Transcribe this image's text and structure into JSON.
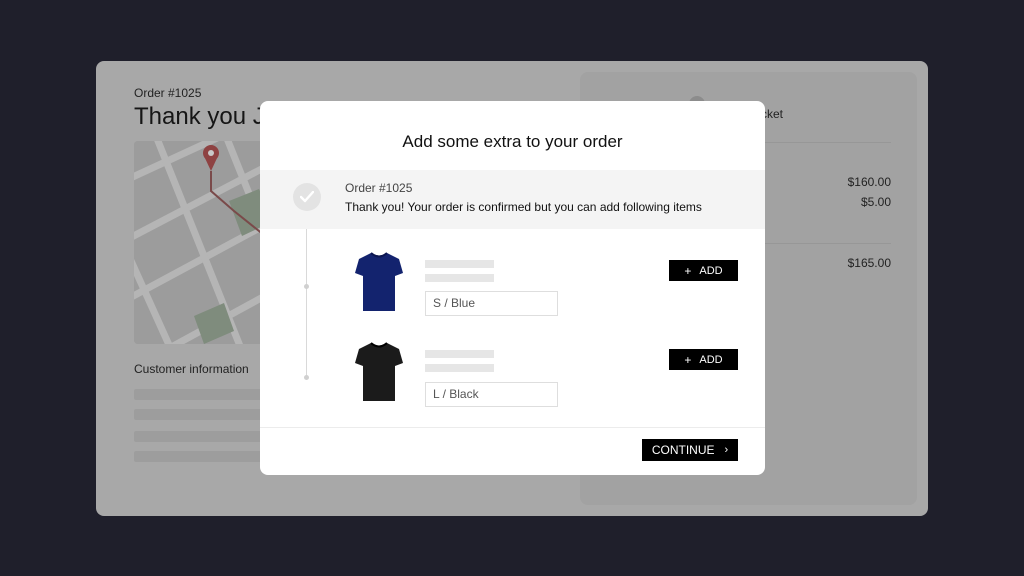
{
  "background": {
    "order_number": "Order #1025",
    "thank_you": "Thank you Je",
    "customer_info_label": "Customer  information",
    "summary": {
      "header_label": "cket",
      "prices": [
        "$160.00",
        "$5.00",
        "$165.00"
      ]
    }
  },
  "modal": {
    "title": "Add some extra to your order",
    "confirmation": {
      "order_number": "Order #1025",
      "message": "Thank you! Your order is confirmed but you can add following items"
    },
    "items": [
      {
        "variant": "S / Blue",
        "color": "#13236e",
        "add_label": "ADD",
        "add_icon": "+"
      },
      {
        "variant": "L / Black",
        "color": "#1b1b1b",
        "add_label": "ADD",
        "add_icon": "+"
      }
    ],
    "continue_label": "CONTINUE",
    "continue_icon": "chevron-right-icon"
  },
  "colors": {
    "page_background": "#1f1f2b",
    "button": "#000000",
    "band": "#f4f4f4"
  }
}
